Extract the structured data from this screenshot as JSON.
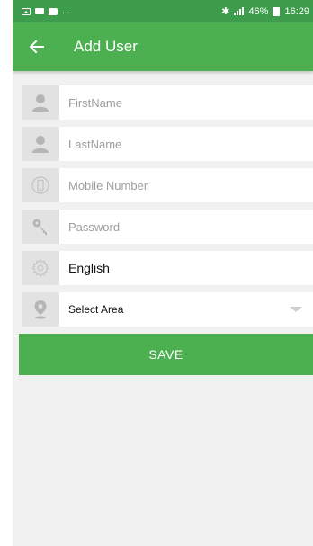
{
  "status_bar": {
    "dots": "...",
    "bluetooth": "✱",
    "battery_percent": "46%",
    "time": "16:29"
  },
  "app_bar": {
    "title": "Add User"
  },
  "form": {
    "first_name": {
      "placeholder": "FirstName",
      "value": ""
    },
    "last_name": {
      "placeholder": "LastName",
      "value": ""
    },
    "mobile": {
      "placeholder": "Mobile Number",
      "value": ""
    },
    "password": {
      "placeholder": "Password",
      "value": ""
    },
    "language": {
      "value": "English"
    },
    "area": {
      "selected": "Select Area"
    },
    "save_label": "SAVE"
  },
  "colors": {
    "primary": "#4caf50",
    "status_bar": "#3d9d4c",
    "icon_box": "#e2e2e2",
    "background": "#f1f1f1"
  },
  "icons": [
    "back-arrow-icon",
    "person-icon",
    "phone-icon",
    "key-icon",
    "gear-icon",
    "location-pin-icon",
    "chevron-down-icon"
  ]
}
